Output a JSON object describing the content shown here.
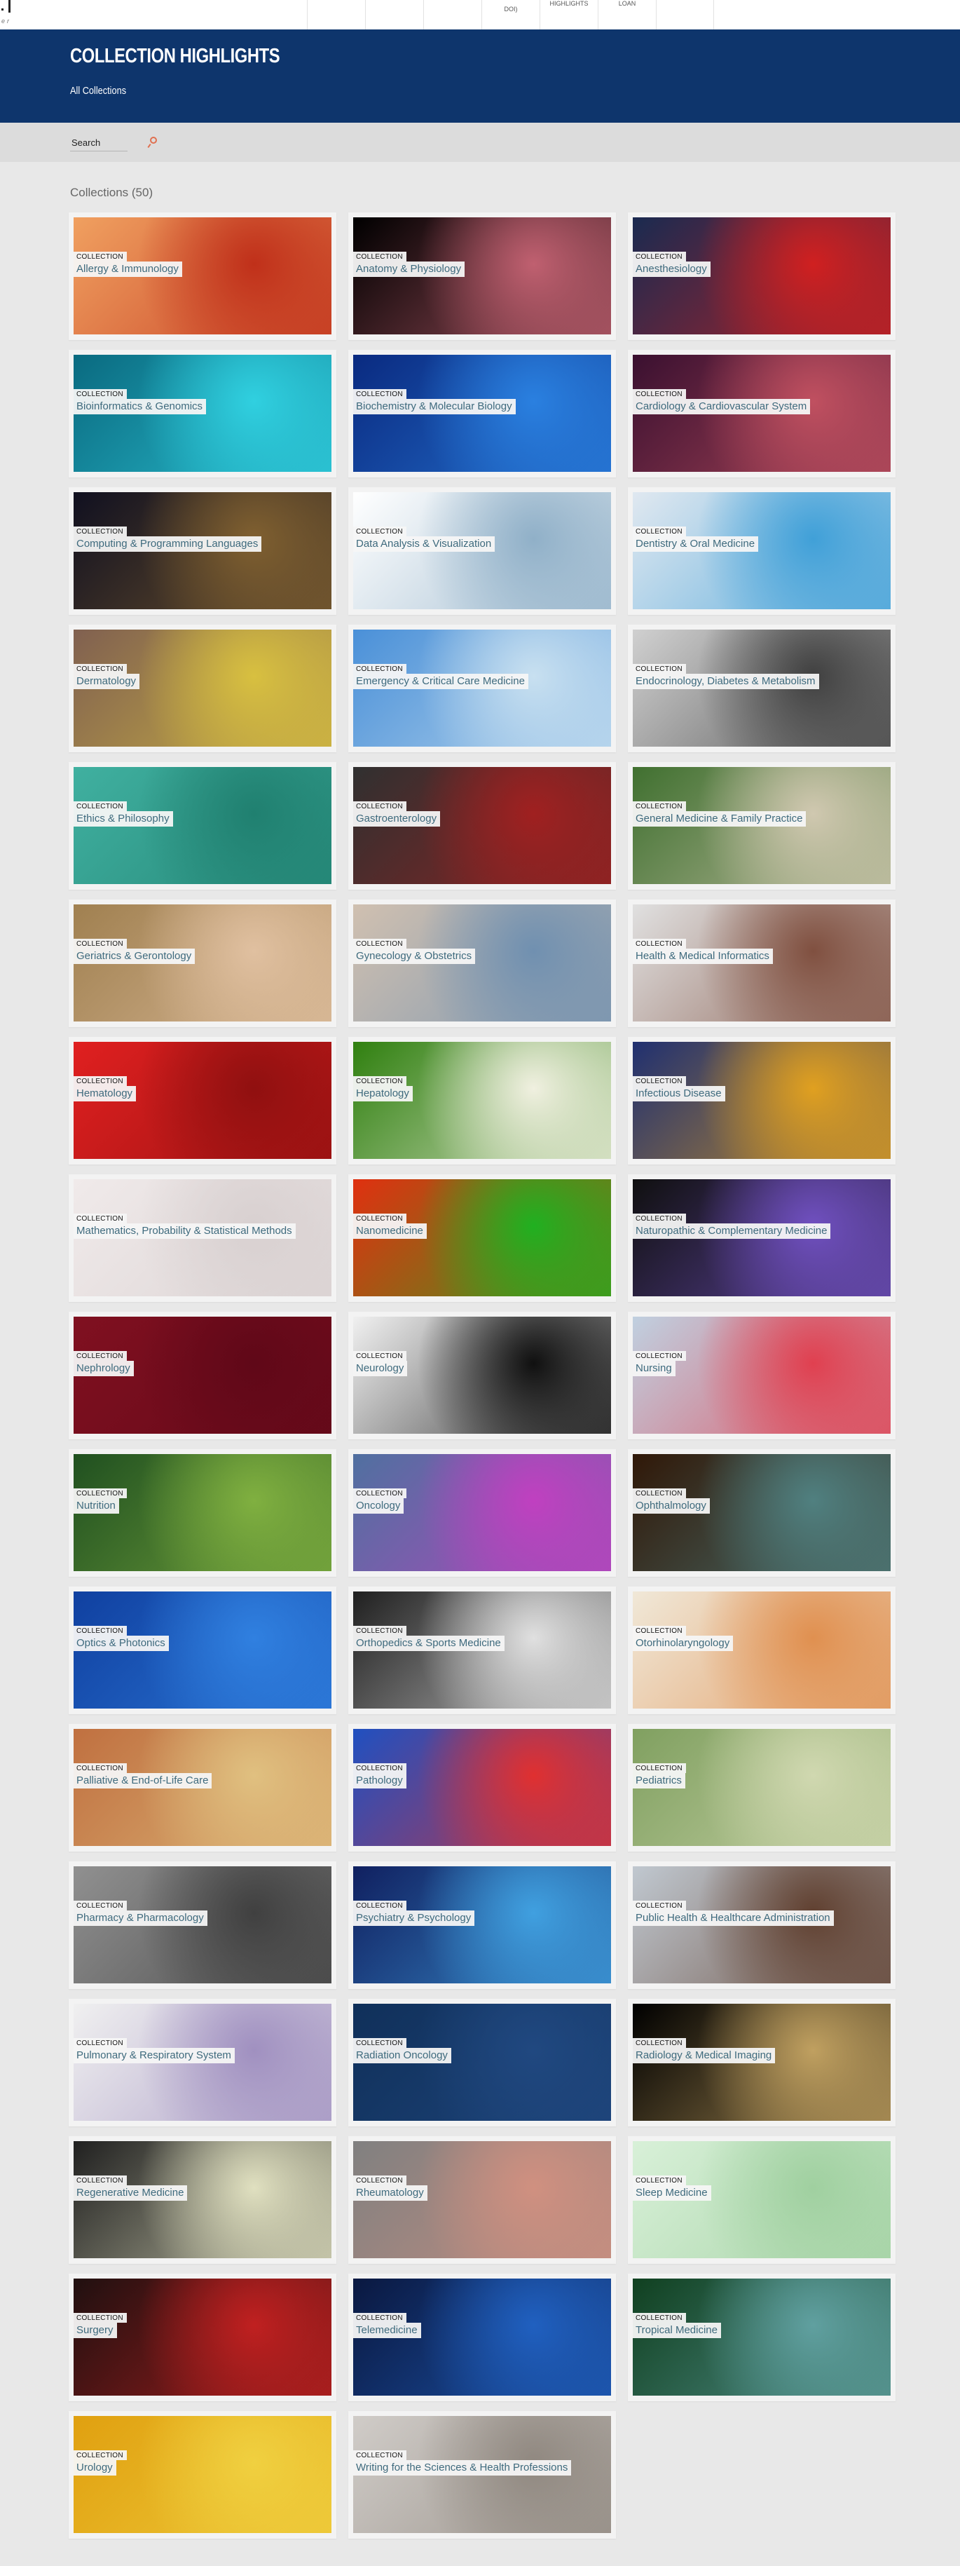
{
  "topbar": {
    "logo_text": "er",
    "nav": [
      {
        "label": ""
      },
      {
        "label": ""
      },
      {
        "label": ""
      },
      {
        "label": "DOI)"
      },
      {
        "label": "HIGHLIGHTS"
      },
      {
        "label": "LOAN"
      },
      {
        "label": ""
      }
    ]
  },
  "hero": {
    "title": "COLLECTION HIGHLIGHTS",
    "breadcrumb": "All Collections",
    "color": "#0e356c"
  },
  "search": {
    "placeholder": "Search",
    "icon": "search-icon",
    "icon_color": "#e07050"
  },
  "collections": {
    "heading": "Collections (50)",
    "tag": "COLLECTION",
    "title_color": "#3e6a7d",
    "items": [
      {
        "title": "Allergy & Immunology",
        "colors": [
          "#f0a060",
          "#c0301a"
        ]
      },
      {
        "title": "Anatomy & Physiology",
        "colors": [
          "#000000",
          "#c06070"
        ]
      },
      {
        "title": "Anesthesiology",
        "colors": [
          "#1a2a50",
          "#d02020"
        ]
      },
      {
        "title": "Bioinformatics & Genomics",
        "colors": [
          "#0a6a80",
          "#30d0e0"
        ]
      },
      {
        "title": "Biochemistry & Molecular Biology",
        "colors": [
          "#0a2a80",
          "#2a80e0"
        ]
      },
      {
        "title": "Cardiology & Cardiovascular System",
        "colors": [
          "#3a1030",
          "#c05060"
        ]
      },
      {
        "title": "Computing & Programming Languages",
        "colors": [
          "#101020",
          "#806030"
        ]
      },
      {
        "title": "Data Analysis & Visualization",
        "colors": [
          "#ffffff",
          "#90b0c8"
        ]
      },
      {
        "title": "Dentistry & Oral Medicine",
        "colors": [
          "#e0e8f0",
          "#40a0d8"
        ]
      },
      {
        "title": "Dermatology",
        "colors": [
          "#806050",
          "#d8c040"
        ]
      },
      {
        "title": "Emergency & Critical Care Medicine",
        "colors": [
          "#4a90d8",
          "#c8e0f0"
        ]
      },
      {
        "title": "Endocrinology, Diabetes & Metabolism",
        "colors": [
          "#d0d0d0",
          "#404040"
        ]
      },
      {
        "title": "Ethics & Philosophy",
        "colors": [
          "#40b0a0",
          "#208070"
        ]
      },
      {
        "title": "Gastroenterology",
        "colors": [
          "#303030",
          "#a02020"
        ]
      },
      {
        "title": "General Medicine & Family Practice",
        "colors": [
          "#407030",
          "#d0c8b0"
        ]
      },
      {
        "title": "Geriatrics & Gerontology",
        "colors": [
          "#a08050",
          "#e0c0a0"
        ]
      },
      {
        "title": "Gynecology & Obstetrics",
        "colors": [
          "#d0c0b0",
          "#7090b0"
        ]
      },
      {
        "title": "Health & Medical Informatics",
        "colors": [
          "#e0e0e0",
          "#805040"
        ]
      },
      {
        "title": "Hematology",
        "colors": [
          "#e02020",
          "#901010"
        ]
      },
      {
        "title": "Hepatology",
        "colors": [
          "#308010",
          "#f0f0e0"
        ]
      },
      {
        "title": "Infectious Disease",
        "colors": [
          "#203070",
          "#e0a020"
        ]
      },
      {
        "title": "Mathematics, Probability & Statistical Methods",
        "colors": [
          "#f0eaea",
          "#d8d0d0"
        ]
      },
      {
        "title": "Nanomedicine",
        "colors": [
          "#e03010",
          "#20b020"
        ]
      },
      {
        "title": "Naturopathic & Complementary Medicine",
        "colors": [
          "#101010",
          "#7050c0"
        ]
      },
      {
        "title": "Nephrology",
        "colors": [
          "#801020",
          "#600818"
        ]
      },
      {
        "title": "Neurology",
        "colors": [
          "#f0f0f0",
          "#101010"
        ]
      },
      {
        "title": "Nursing",
        "colors": [
          "#c0d0e0",
          "#e04050"
        ]
      },
      {
        "title": "Nutrition",
        "colors": [
          "#205020",
          "#80b040"
        ]
      },
      {
        "title": "Oncology",
        "colors": [
          "#5070a0",
          "#c040c0"
        ]
      },
      {
        "title": "Ophthalmology",
        "colors": [
          "#301808",
          "#508080"
        ]
      },
      {
        "title": "Optics & Photonics",
        "colors": [
          "#1040a0",
          "#3080e0"
        ]
      },
      {
        "title": "Orthopedics & Sports Medicine",
        "colors": [
          "#202020",
          "#e0e0e0"
        ]
      },
      {
        "title": "Otorhinolaryngology",
        "colors": [
          "#f0e8d8",
          "#e09050"
        ]
      },
      {
        "title": "Palliative & End-of-Life Care",
        "colors": [
          "#c07040",
          "#e0c080"
        ]
      },
      {
        "title": "Pathology",
        "colors": [
          "#2050c0",
          "#e03030"
        ]
      },
      {
        "title": "Pediatrics",
        "colors": [
          "#80a060",
          "#d0d8b0"
        ]
      },
      {
        "title": "Pharmacy & Pharmacology",
        "colors": [
          "#909090",
          "#404040"
        ]
      },
      {
        "title": "Psychiatry & Psychology",
        "colors": [
          "#102060",
          "#40a0e0"
        ]
      },
      {
        "title": "Public Health & Healthcare Administration",
        "colors": [
          "#c0c8d0",
          "#604030"
        ]
      },
      {
        "title": "Pulmonary & Respiratory System",
        "colors": [
          "#f0f0f0",
          "#a090c0"
        ]
      },
      {
        "title": "Radiation Oncology",
        "colors": [
          "#10305a",
          "#204880"
        ]
      },
      {
        "title": "Radiology & Medical Imaging",
        "colors": [
          "#000000",
          "#c0a060"
        ]
      },
      {
        "title": "Regenerative Medicine",
        "colors": [
          "#202020",
          "#e0e0c0"
        ]
      },
      {
        "title": "Rheumatology",
        "colors": [
          "#808080",
          "#d09080"
        ]
      },
      {
        "title": "Sleep Medicine",
        "colors": [
          "#d8f0d8",
          "#a0d0a0"
        ]
      },
      {
        "title": "Surgery",
        "colors": [
          "#201010",
          "#c02020"
        ]
      },
      {
        "title": "Telemedicine",
        "colors": [
          "#0a1840",
          "#2060c0"
        ]
      },
      {
        "title": "Tropical Medicine",
        "colors": [
          "#104020",
          "#60a0a0"
        ]
      },
      {
        "title": "Urology",
        "colors": [
          "#e0a010",
          "#f0d040"
        ]
      },
      {
        "title": "Writing for the Sciences & Health Professions",
        "colors": [
          "#d0ccc8",
          "#908880"
        ]
      }
    ]
  }
}
